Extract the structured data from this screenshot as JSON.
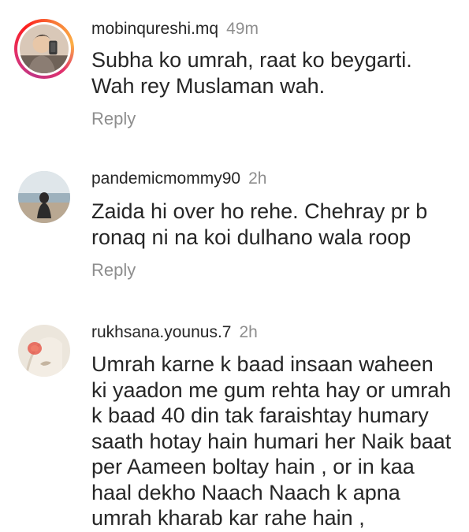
{
  "comments": [
    {
      "username": "mobinqureshi.mq",
      "time": "49m",
      "text": "Subha ko umrah, raat ko beygarti. Wah rey Muslaman wah.",
      "reply_label": "Reply",
      "has_story": true
    },
    {
      "username": "pandemicmommy90",
      "time": "2h",
      "text": "Zaida hi over ho rehe. Chehray pr b ronaq ni na koi dulhano wala roop",
      "reply_label": "Reply",
      "has_story": false
    },
    {
      "username": "rukhsana.younus.7",
      "time": "2h",
      "text": "Umrah karne k baad insaan waheen ki yaadon me gum rehta hay or umrah k baad 40 din tak faraishtay humary saath hotay hain humari her Naik baat per Aameen boltay hain , or in kaa haal dekho Naach Naach k apna umrah kharab kar rahe hain ,",
      "has_story": false
    }
  ],
  "colors": {
    "primary_text": "#262626",
    "secondary_text": "#8e8e8e",
    "background": "#ffffff"
  }
}
